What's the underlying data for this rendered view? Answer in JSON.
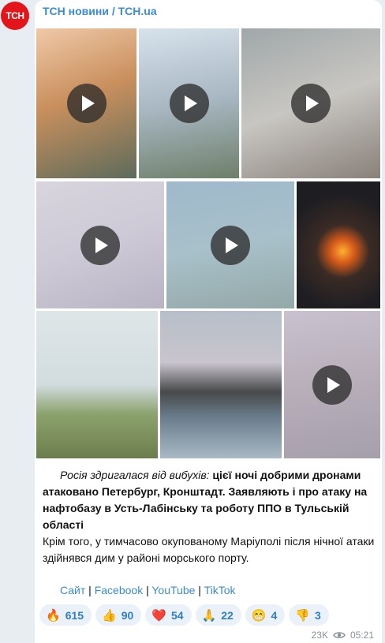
{
  "channel": {
    "avatar_text": "TCH",
    "title": "ТСН новини / TCH.ua"
  },
  "media": [
    {
      "name": "video-thumb-1",
      "type": "video",
      "bg": "linear-gradient(160deg,#f0c9a8 0%,#c98f5d 45%,#5d6b5c 100%)"
    },
    {
      "name": "video-thumb-2",
      "type": "video",
      "bg": "linear-gradient(170deg,#d7e2ec 0%,#a8b7c2 50%,#6e7f6a 100%)"
    },
    {
      "name": "video-thumb-3",
      "type": "video",
      "bg": "linear-gradient(160deg,#a0a7a9 0%,#c8c6c2 50%,#898079 100%)"
    },
    {
      "name": "video-thumb-4",
      "type": "video",
      "bg": "linear-gradient(160deg,#d8d5de 0%,#cdc9d6 50%,#b8b4c4 100%)"
    },
    {
      "name": "video-thumb-5",
      "type": "video",
      "bg": "linear-gradient(170deg,#9fb9cc 0%,#a8c0c9 50%,#93a8a8 100%)"
    },
    {
      "name": "photo-fire-night",
      "type": "photo",
      "bg": "radial-gradient(circle at 55% 55%,#ffb030 0%,#d65b1b 14%,#3a2b25 32%,#1e1d22 70%)"
    },
    {
      "name": "photo-smoke-town",
      "type": "photo",
      "bg": "linear-gradient(180deg,#dfe6e8 0%,#d2dcdf 50%,#8ca26d 70%,#6c7d4d 100%)"
    },
    {
      "name": "photo-smoke-sea",
      "type": "photo",
      "bg": "linear-gradient(180deg,#b6bfc9 0%,#c9c4cd 35%,#47494a 55%,#6a7c8c 72%,#a9bac5 100%)"
    },
    {
      "name": "video-thumb-6",
      "type": "video",
      "bg": "linear-gradient(170deg,#c9c1cf 0%,#b7aeb9 50%,#a59fac 100%)"
    }
  ],
  "message": {
    "p1_italic": "Росія здригалася від вибухів:",
    "p1_bold": " цієї ночі добрими дронами атаковано Петербург, Кронштадт. Заявляють і про атаку на нафтобазу в Усть-Лабінську та роботу ППО в Тульській області",
    "p2": "Крім того, у тимчасово окупованому Маріуполі після нічної атаки здійнявся дим у районі морського порту."
  },
  "links": {
    "site": "Сайт",
    "facebook": "Facebook",
    "youtube": "YouTube",
    "tiktok": "TikTok",
    "sep": " | "
  },
  "reactions": [
    {
      "emoji": "🔥",
      "name": "fire",
      "count": "615"
    },
    {
      "emoji": "👍",
      "name": "thumbs-up",
      "count": "90"
    },
    {
      "emoji": "❤️",
      "name": "heart",
      "count": "54"
    },
    {
      "emoji": "🙏",
      "name": "pray",
      "count": "22"
    },
    {
      "emoji": "😁",
      "name": "grin",
      "count": "4"
    },
    {
      "emoji": "👎",
      "name": "thumbs-down",
      "count": "3"
    }
  ],
  "footer": {
    "views": "23K",
    "time": "05:21"
  }
}
